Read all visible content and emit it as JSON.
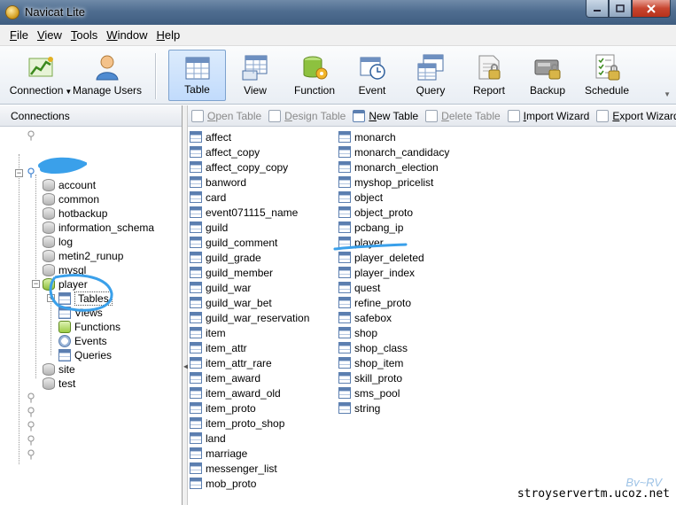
{
  "window": {
    "title": "Navicat Lite",
    "controls": {
      "minimize_icon": "minimize-icon",
      "maximize_icon": "maximize-icon",
      "close_icon": "close-icon"
    }
  },
  "menu": [
    "File",
    "View",
    "Tools",
    "Window",
    "Help"
  ],
  "toolbar": {
    "connection": "Connection",
    "manage_users": "Manage Users",
    "buttons": [
      "Table",
      "View",
      "Function",
      "Event",
      "Query",
      "Report",
      "Backup",
      "Schedule"
    ],
    "active": "Table"
  },
  "connections_panel": {
    "header": "Connections",
    "connection_name": "",
    "databases_before": [
      "account",
      "common",
      "hotbackup",
      "information_schema",
      "log",
      "metin2_runup",
      "mysql"
    ],
    "open_database": "player",
    "children": [
      "Tables",
      "Views",
      "Functions",
      "Events",
      "Queries"
    ],
    "selected_child": "Tables",
    "databases_after": [
      "site",
      "test"
    ],
    "other_connections_count": 5
  },
  "object_toolbar": {
    "open_table": "Open Table",
    "design_table": "Design Table",
    "new_table": "New Table",
    "delete_table": "Delete Table",
    "import_wizard": "Import Wizard",
    "export_wizard": "Export Wizard"
  },
  "tables_col1": [
    "affect",
    "affect_copy",
    "affect_copy_copy",
    "banword",
    "card",
    "event071115_name",
    "guild",
    "guild_comment",
    "guild_grade",
    "guild_member",
    "guild_war",
    "guild_war_bet",
    "guild_war_reservation",
    "item",
    "item_attr",
    "item_attr_rare",
    "item_award",
    "item_award_old",
    "item_proto",
    "item_proto_shop",
    "land",
    "marriage",
    "messenger_list",
    "mob_proto"
  ],
  "tables_col2": [
    "monarch",
    "monarch_candidacy",
    "monarch_election",
    "myshop_pricelist",
    "object",
    "object_proto",
    "pcbang_ip",
    "player",
    "player_deleted",
    "player_index",
    "quest",
    "refine_proto",
    "safebox",
    "shop",
    "shop_class",
    "shop_item",
    "skill_proto",
    "sms_pool",
    "string"
  ],
  "watermark": "stroyservertm.ucoz.net",
  "signature": "By~RV",
  "colors": {
    "annotation": "#3aa0ea",
    "selection_border": "#7da2ce"
  }
}
